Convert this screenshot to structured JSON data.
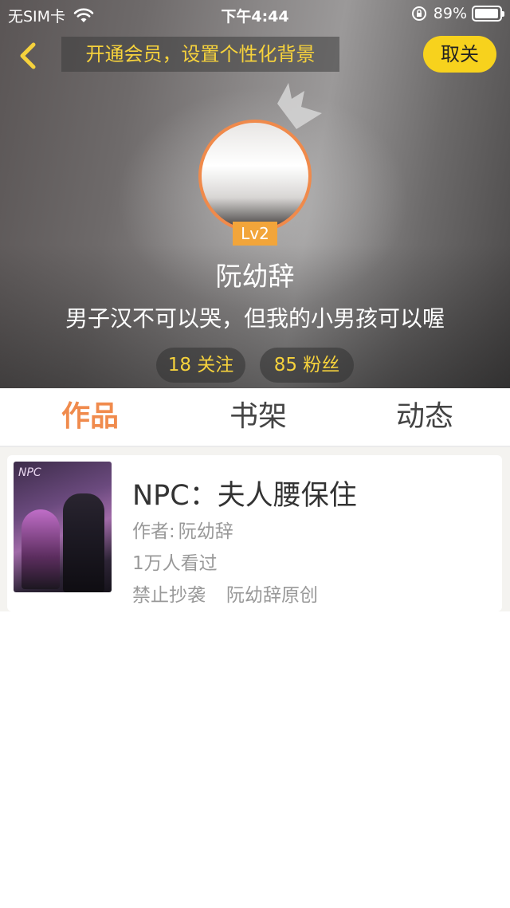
{
  "status_bar": {
    "carrier": "无SIM卡",
    "time": "下午4:44",
    "battery": "89%"
  },
  "nav": {
    "banner": "开通会员，设置个性化背景",
    "unfollow_label": "取关"
  },
  "profile": {
    "level": "Lv2",
    "name": "阮幼辞",
    "bio": "男子汉不可以哭，但我的小男孩可以喔",
    "following": "18 关注",
    "fans": "85 粉丝"
  },
  "tabs": [
    {
      "label": "作品"
    },
    {
      "label": "书架"
    },
    {
      "label": "动态"
    }
  ],
  "works": [
    {
      "cover_text": "NPC",
      "title": "NPC：夫人腰保住",
      "author_label": "作者:",
      "author": "阮幼辞",
      "views": "1万人看过",
      "tags": [
        "禁止抄袭",
        "阮幼辞原创"
      ]
    }
  ],
  "colors": {
    "accent_orange": "#f08b4d",
    "accent_yellow": "#f7d21d",
    "banner_text": "#f6d23c"
  }
}
